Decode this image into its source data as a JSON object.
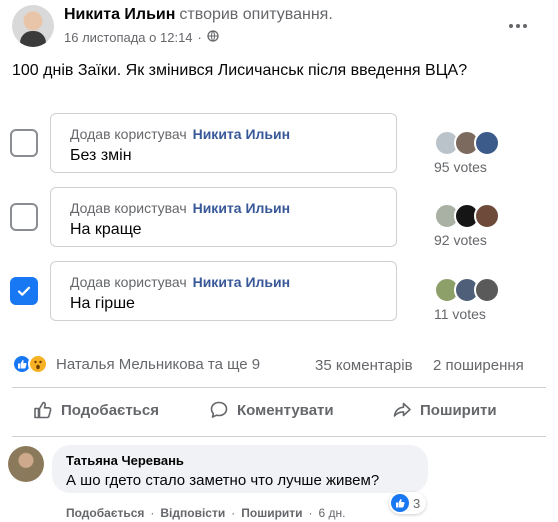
{
  "post": {
    "author": "Никита Ильин",
    "action": "створив опитування.",
    "date": "16 листопада о 12:14",
    "dot": "·",
    "text": "100 днів Заїки. Як змінився Лисичанськ після введення ВЦА?"
  },
  "poll": {
    "added_by_prefix": "Додав користувач",
    "options": [
      {
        "label": "Без змін",
        "added_by": "Никита Ильин",
        "votes": "95 votes",
        "checked": false
      },
      {
        "label": "На краще",
        "added_by": "Никита Ильин",
        "votes": "92 votes",
        "checked": false
      },
      {
        "label": "На гірше",
        "added_by": "Никита Ильин",
        "votes": "11 votes",
        "checked": true
      }
    ]
  },
  "reactions": {
    "summary": "Наталья Мельникова та ще 9",
    "comments": "35 коментарів",
    "shares": "2 поширення"
  },
  "actions": {
    "like": "Подобається",
    "comment": "Коментувати",
    "share": "Поширити"
  },
  "comment": {
    "author": "Татьяна Черевань",
    "text": "А шо гдето стало заметно что лучше живем?",
    "reaction_count": "3",
    "like": "Подобається",
    "reply": "Відповісти",
    "share": "Поширити",
    "sep": "·",
    "time": "6 дн."
  },
  "colors": {
    "accent": "#1877f2",
    "link": "#385898",
    "muted": "#65676b",
    "border": "#ced0d4",
    "bubble": "#f0f2f5"
  }
}
